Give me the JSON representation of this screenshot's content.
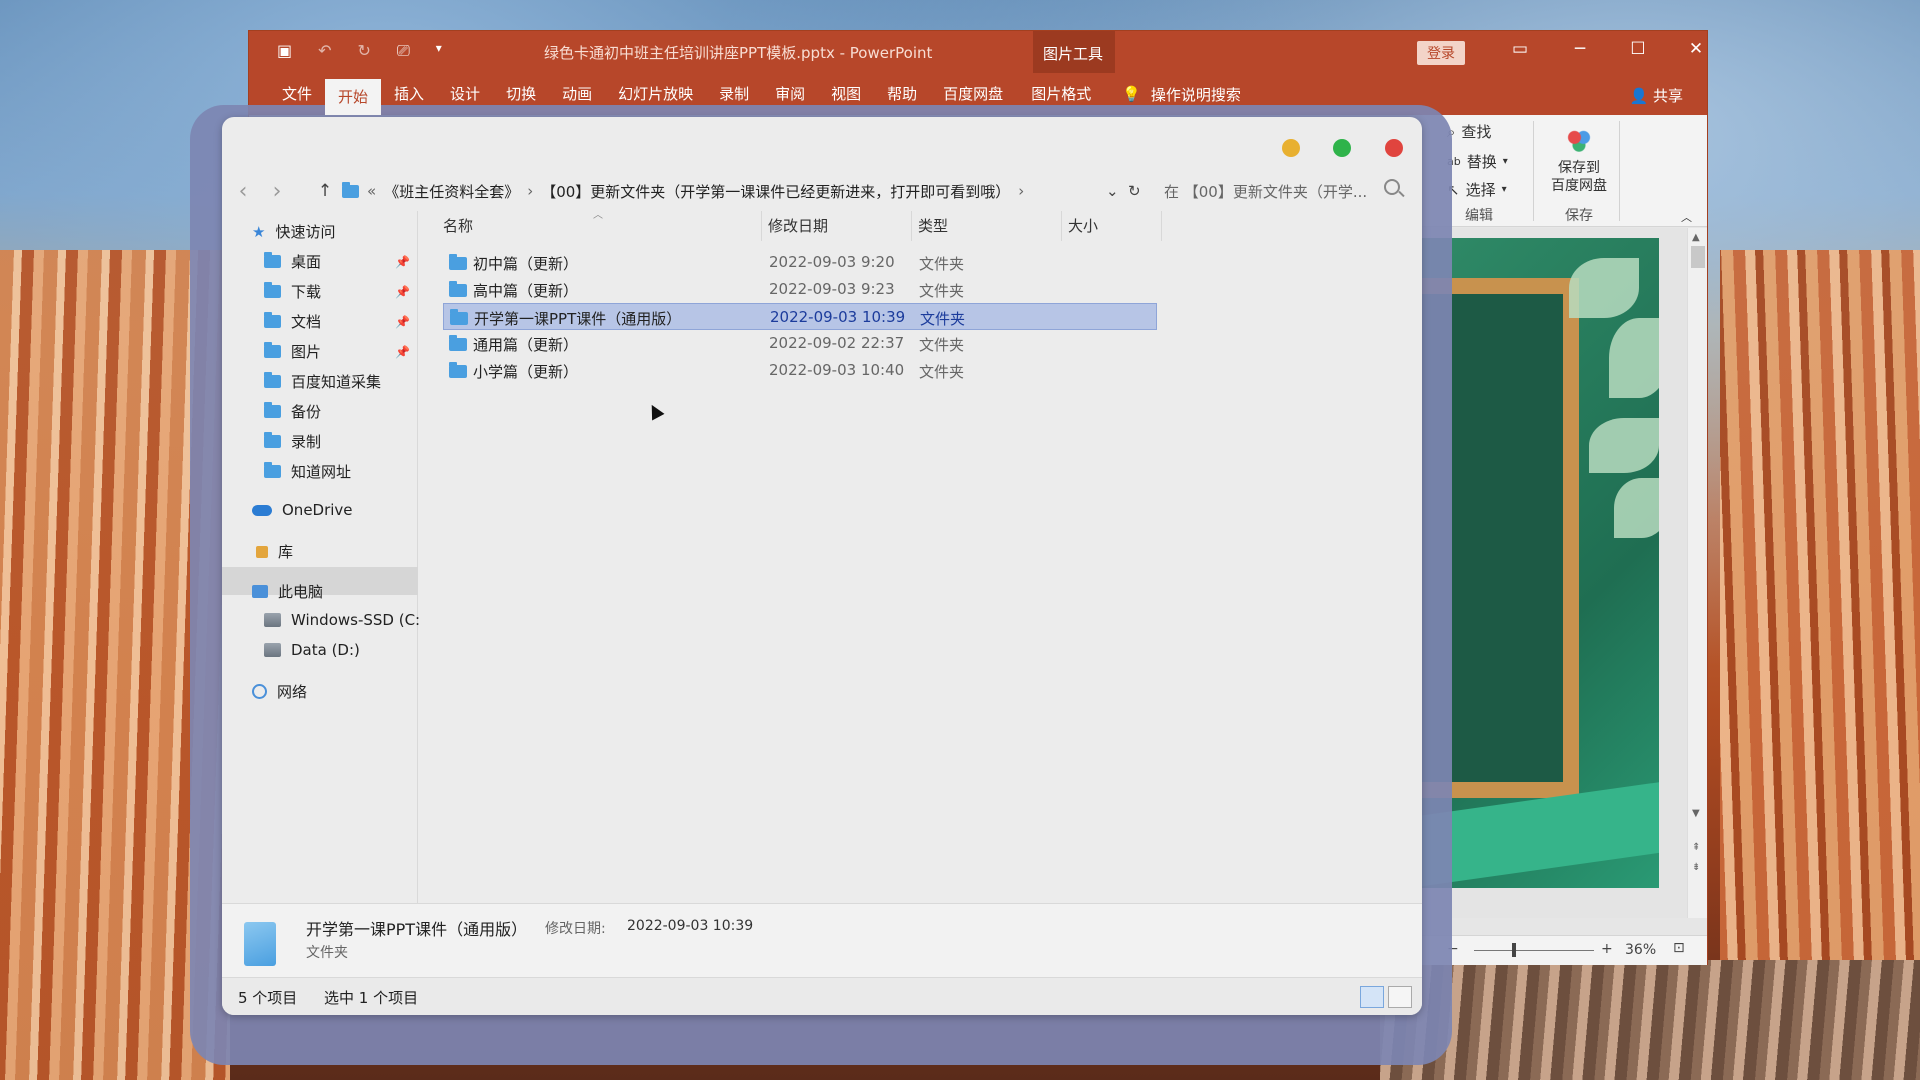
{
  "ppt": {
    "title": "绿色卡通初中班主任培训讲座PPT模板.pptx  -  PowerPoint",
    "context_group": "图片工具",
    "login_label": "登录",
    "tabs": [
      "文件",
      "开始",
      "插入",
      "设计",
      "切换",
      "动画",
      "幻灯片放映",
      "录制",
      "审阅",
      "视图",
      "帮助",
      "百度网盘",
      "图片格式"
    ],
    "active_tab": "开始",
    "tell_me": "操作说明搜索",
    "share": "共享",
    "ribbon": {
      "find": "查找",
      "replace": "替换",
      "select": "选择",
      "edit_group": "编辑",
      "save_to": "保存到",
      "baidu_pan": "百度网盘",
      "save_group": "保存"
    },
    "zoom": "36%"
  },
  "explorer": {
    "breadcrumb": {
      "overflow": "«",
      "parent": "《班主任资料全套》",
      "sep": "›",
      "current": "【00】更新文件夹（开学第一课课件已经更新进来，打开即可看到哦）"
    },
    "search_placeholder": "在 【00】更新文件夹（开学...",
    "sidebar": {
      "quick_access": "快速访问",
      "quick_items": [
        {
          "label": "桌面",
          "pinned": true
        },
        {
          "label": "下载",
          "pinned": true
        },
        {
          "label": "文档",
          "pinned": true
        },
        {
          "label": "图片",
          "pinned": true
        },
        {
          "label": "百度知道采集",
          "pinned": false
        },
        {
          "label": "备份",
          "pinned": false
        },
        {
          "label": "录制",
          "pinned": false
        },
        {
          "label": "知道网址",
          "pinned": false
        }
      ],
      "onedrive": "OneDrive",
      "library": "库",
      "this_pc": "此电脑",
      "drives": [
        "Windows-SSD (C:)",
        "Data (D:)"
      ],
      "network": "网络"
    },
    "columns": {
      "name": "名称",
      "modified": "修改日期",
      "type": "类型",
      "size": "大小"
    },
    "rows": [
      {
        "name": "初中篇（更新）",
        "modified": "2022-09-03 9:20",
        "type": "文件夹"
      },
      {
        "name": "高中篇（更新）",
        "modified": "2022-09-03 9:23",
        "type": "文件夹"
      },
      {
        "name": "开学第一课PPT课件（通用版）",
        "modified": "2022-09-03 10:39",
        "type": "文件夹"
      },
      {
        "name": "通用篇（更新）",
        "modified": "2022-09-02 22:37",
        "type": "文件夹"
      },
      {
        "name": "小学篇（更新）",
        "modified": "2022-09-03 10:40",
        "type": "文件夹"
      }
    ],
    "selected_index": 2,
    "details": {
      "name": "开学第一课PPT课件（通用版）",
      "modified_label": "修改日期:",
      "modified": "2022-09-03 10:39",
      "kind": "文件夹"
    },
    "status": {
      "count": "5 个项目",
      "selected": "选中 1 个项目"
    }
  },
  "colors": {
    "ppt_accent": "#b7472a",
    "selection": "#b7c5e6",
    "folder": "#4a9fe0",
    "close": "#e0443e",
    "minimize": "#e8b030",
    "maximize": "#2fb34a"
  }
}
